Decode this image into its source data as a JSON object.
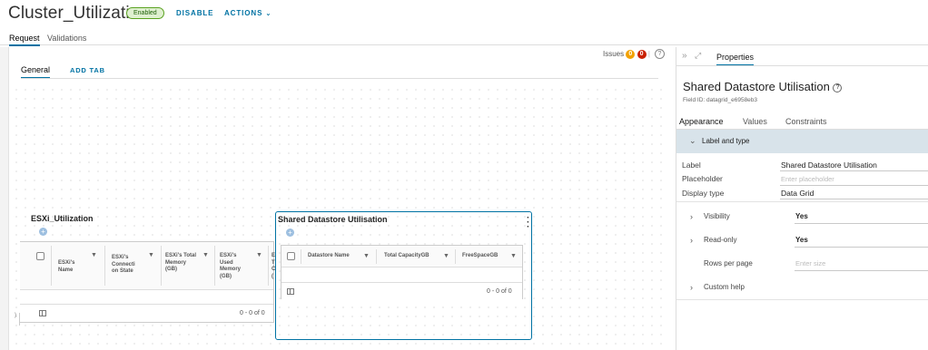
{
  "header": {
    "title": "Cluster_Utilization",
    "badge": "Enabled",
    "disable_label": "DISABLE",
    "actions_label": "ACTIONS",
    "actions_chevron": "⌄"
  },
  "top_tabs": [
    {
      "label": "Request",
      "active": true
    },
    {
      "label": "Validations",
      "active": false
    }
  ],
  "issues": {
    "label": "Issues",
    "warning_count": "0",
    "error_count": "0",
    "warning_color": "#f2a100",
    "error_color": "#c92100",
    "help_icon": "question-circle-icon"
  },
  "form_tabs": {
    "general": "General",
    "add_tab": "ADD TAB"
  },
  "grids": {
    "esxi": {
      "title": "ESXi_Utilization",
      "columns": [
        "ESXi's Name",
        "ESXi's Connecti on State",
        "ESXi's Total Memory (GB)",
        "ESXi's Used Memory (GB)",
        "E T C ("
      ],
      "pager": "0 - 0 of 0"
    },
    "shared": {
      "title": "Shared Datastore Utilisation",
      "columns": [
        "Datastore Name",
        "Total CapacityGB",
        "FreeSpaceGB"
      ],
      "pager": "0 - 0 of 0"
    }
  },
  "panel": {
    "expand_icon": "double-chevron-right-icon",
    "fullscreen_icon": "expand-arrows-icon",
    "properties_tab": "Properties",
    "field_title": "Shared Datastore Utilisation",
    "field_id": "Field ID: datagrid_e6958eb3",
    "tabs": [
      "Appearance",
      "Values",
      "Constraints"
    ],
    "label_and_type_section": "Label and type",
    "label_label": "Label",
    "label_value": "Shared Datastore Utilisation",
    "placeholder_label": "Placeholder",
    "placeholder_hint": "Enter placeholder",
    "display_type_label": "Display type",
    "display_type_value": "Data Grid",
    "visibility_label": "Visibility",
    "visibility_value": "Yes",
    "readonly_label": "Read-only",
    "readonly_value": "Yes",
    "rows_per_page_label": "Rows per page",
    "rows_per_page_hint": "Enter size",
    "custom_help_label": "Custom help"
  },
  "colors": {
    "accent": "#0072a3",
    "section_bg": "#d8e3ea"
  }
}
